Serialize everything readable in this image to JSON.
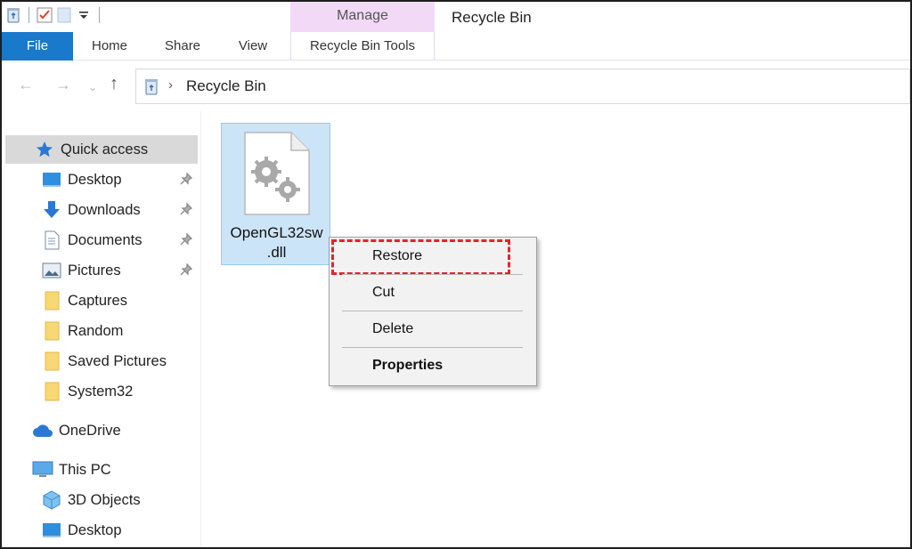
{
  "window": {
    "title": "Recycle Bin",
    "contextual_group": "Manage"
  },
  "ribbon": {
    "tabs": [
      {
        "label": "File"
      },
      {
        "label": "Home"
      },
      {
        "label": "Share"
      },
      {
        "label": "View"
      },
      {
        "label": "Recycle Bin Tools"
      }
    ]
  },
  "address": {
    "path": "Recycle Bin"
  },
  "sidebar": {
    "quick_access": "Quick access",
    "items": [
      {
        "label": "Desktop",
        "icon": "desktop-icon",
        "pinned": true
      },
      {
        "label": "Downloads",
        "icon": "download-icon",
        "pinned": true
      },
      {
        "label": "Documents",
        "icon": "documents-icon",
        "pinned": true
      },
      {
        "label": "Pictures",
        "icon": "pictures-icon",
        "pinned": true
      },
      {
        "label": "Captures",
        "icon": "folder-icon",
        "pinned": false
      },
      {
        "label": "Random",
        "icon": "folder-icon",
        "pinned": false
      },
      {
        "label": "Saved Pictures",
        "icon": "folder-icon",
        "pinned": false
      },
      {
        "label": "System32",
        "icon": "folder-icon",
        "pinned": false
      }
    ],
    "onedrive": "OneDrive",
    "this_pc": "This PC",
    "pc_items": [
      {
        "label": "3D Objects",
        "icon": "cube-icon"
      },
      {
        "label": "Desktop",
        "icon": "desktop-icon"
      }
    ]
  },
  "files": [
    {
      "name_line1": "OpenGL32sw",
      "name_line2": ".dll",
      "icon": "system-file-icon",
      "selected": true
    }
  ],
  "context_menu": {
    "items": [
      "Restore",
      "Cut",
      "Delete",
      "Properties"
    ],
    "highlighted": "Restore"
  },
  "colors": {
    "file_tab": "#1979ca",
    "manage_tab": "#f2daf7",
    "selection": "#cce4f7",
    "highlight_border": "#e5232a",
    "folder": "#f8d775"
  }
}
